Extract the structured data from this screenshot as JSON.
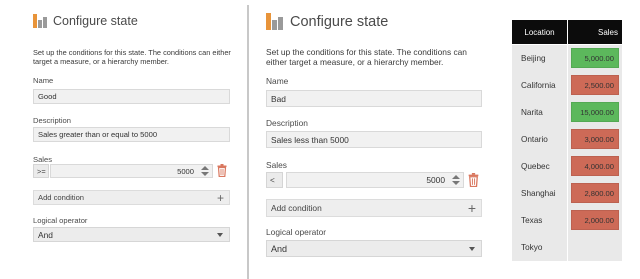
{
  "colors": {
    "good": "#5cb85c",
    "bad": "#cd6a57",
    "header_bg": "#0c0c0c",
    "logo_orange": "#e8943a",
    "logo_gray": "#9a9a9a"
  },
  "left_panel": {
    "title": "Configure state",
    "description": "Set up the conditions for this state. The conditions can either target a measure, or a hierarchy member.",
    "name_label": "Name",
    "name_value": "Good",
    "description_label": "Description",
    "description_value": "Sales greater than or equal to 5000",
    "sales_label": "Sales",
    "operator": ">=",
    "sales_value": "5000",
    "add_condition_label": "Add condition",
    "logical_operator_label": "Logical operator",
    "logical_operator_value": "And"
  },
  "right_panel": {
    "title": "Configure state",
    "description": "Set up the conditions for this state. The conditions can either target a measure, or a hierarchy member.",
    "name_label": "Name",
    "name_value": "Bad",
    "description_label": "Description",
    "description_value": "Sales less than 5000",
    "sales_label": "Sales",
    "operator": "<",
    "sales_value": "5000",
    "add_condition_label": "Add condition",
    "logical_operator_label": "Logical operator",
    "logical_operator_value": "And"
  },
  "table": {
    "headers": {
      "location": "Location",
      "sales": "Sales"
    },
    "rows": [
      {
        "location": "Beijing",
        "sales": "5,000.00",
        "state": "good"
      },
      {
        "location": "California",
        "sales": "2,500.00",
        "state": "bad"
      },
      {
        "location": "Narita",
        "sales": "15,000.00",
        "state": "good"
      },
      {
        "location": "Ontario",
        "sales": "3,000.00",
        "state": "bad"
      },
      {
        "location": "Quebec",
        "sales": "4,000.00",
        "state": "bad"
      },
      {
        "location": "Shanghai",
        "sales": "2,800.00",
        "state": "bad"
      },
      {
        "location": "Texas",
        "sales": "2,000.00",
        "state": "bad"
      },
      {
        "location": "Tokyo",
        "sales": "",
        "state": "none"
      }
    ]
  },
  "icons": {
    "logo": "bar-chart-logo-icon",
    "spinner": "spinner-arrows-icon",
    "delete": "trash-icon",
    "add": "plus-icon",
    "dropdown": "chevron-down-icon"
  }
}
